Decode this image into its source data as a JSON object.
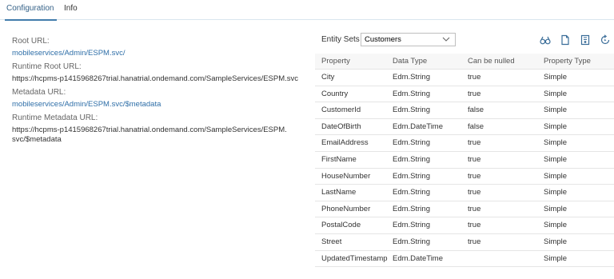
{
  "tabs": [
    {
      "label": "Configuration",
      "selected": true
    },
    {
      "label": "Info",
      "selected": false
    }
  ],
  "config": {
    "items": [
      {
        "label": "Root URL:",
        "value": "mobileservices/Admin/ESPM.svc/",
        "link": true
      },
      {
        "label": "Runtime Root URL:",
        "value": "https://hcpms-p1415968267trial.hanatrial.ondemand.com/SampleServices/ESPM.svc",
        "link": false
      },
      {
        "label": "Metadata URL:",
        "value": "mobileservices/Admin/ESPM.svc/$metadata",
        "link": true
      },
      {
        "label": "Runtime Metadata URL:",
        "value": "https://hcpms-p1415968267trial.hanatrial.ondemand.com/SampleServices/ESPM.svc/$metadata",
        "link": false
      }
    ]
  },
  "entity": {
    "label": "Entity Sets",
    "selected": "Customers",
    "toolbar_icons": [
      "binoculars-icon",
      "document-icon",
      "bookmark-icon",
      "refresh-icon"
    ]
  },
  "table": {
    "columns": [
      "Property",
      "Data Type",
      "Can be nulled",
      "Property Type"
    ],
    "rows": [
      [
        "City",
        "Edm.String",
        "true",
        "Simple"
      ],
      [
        "Country",
        "Edm.String",
        "true",
        "Simple"
      ],
      [
        "CustomerId",
        "Edm.String",
        "false",
        "Simple"
      ],
      [
        "DateOfBirth",
        "Edm.DateTime",
        "false",
        "Simple"
      ],
      [
        "EmailAddress",
        "Edm.String",
        "true",
        "Simple"
      ],
      [
        "FirstName",
        "Edm.String",
        "true",
        "Simple"
      ],
      [
        "HouseNumber",
        "Edm.String",
        "true",
        "Simple"
      ],
      [
        "LastName",
        "Edm.String",
        "true",
        "Simple"
      ],
      [
        "PhoneNumber",
        "Edm.String",
        "true",
        "Simple"
      ],
      [
        "PostalCode",
        "Edm.String",
        "true",
        "Simple"
      ],
      [
        "Street",
        "Edm.String",
        "true",
        "Simple"
      ],
      [
        "UpdatedTimestamp",
        "Edm.DateTime",
        "",
        "Simple"
      ]
    ]
  },
  "colors": {
    "accent": "#427cac",
    "link": "#2f6fa8",
    "header_bg": "#f7f7f7",
    "border": "#e5e5e5"
  }
}
